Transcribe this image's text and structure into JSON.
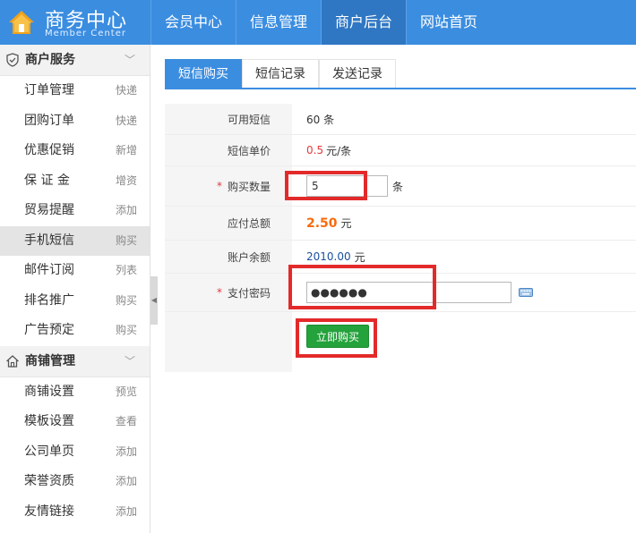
{
  "header": {
    "logo_title": "商务中心",
    "logo_sub": "Member Center",
    "nav": [
      {
        "label": "会员中心"
      },
      {
        "label": "信息管理"
      },
      {
        "label": "商户后台"
      },
      {
        "label": "网站首页"
      }
    ],
    "active_nav": "商户后台"
  },
  "sidebar": {
    "sections": [
      {
        "title": "商户服务",
        "icon": "shield-icon",
        "items": [
          {
            "label": "订单管理",
            "tag": "快递"
          },
          {
            "label": "团购订单",
            "tag": "快递"
          },
          {
            "label": "优惠促销",
            "tag": "新增"
          },
          {
            "label": "保 证 金",
            "tag": "增资"
          },
          {
            "label": "贸易提醒",
            "tag": "添加"
          },
          {
            "label": "手机短信",
            "tag": "购买"
          },
          {
            "label": "邮件订阅",
            "tag": "列表"
          },
          {
            "label": "排名推广",
            "tag": "购买"
          },
          {
            "label": "广告预定",
            "tag": "购买"
          }
        ]
      },
      {
        "title": "商铺管理",
        "icon": "home-icon",
        "items": [
          {
            "label": "商铺设置",
            "tag": "预览"
          },
          {
            "label": "模板设置",
            "tag": "查看"
          },
          {
            "label": "公司单页",
            "tag": "添加"
          },
          {
            "label": "荣誉资质",
            "tag": "添加"
          },
          {
            "label": "友情链接",
            "tag": "添加"
          }
        ]
      }
    ],
    "active_item": "手机短信"
  },
  "tabs": [
    {
      "label": "短信购买"
    },
    {
      "label": "短信记录"
    },
    {
      "label": "发送记录"
    }
  ],
  "form": {
    "available_label": "可用短信",
    "available_value": "60 条",
    "price_label": "短信单价",
    "price_value": "0.5",
    "price_unit": "元/条",
    "qty_label": "购买数量",
    "qty_value": "5",
    "qty_unit": "条",
    "total_label": "应付总额",
    "total_value": "2.50",
    "total_unit": "元",
    "balance_label": "账户余额",
    "balance_value": "2010.00",
    "balance_unit": "元",
    "pwd_label": "支付密码",
    "pwd_value": "●●●●●●",
    "required_mark": "*",
    "submit_label": "立即购买"
  },
  "colors": {
    "brand": "#3b8de0",
    "nav_active": "#2f77c3",
    "button": "#24a23b",
    "price_red": "#e4393c",
    "total_orange": "#f76b0c",
    "highlight": "#e32a2a"
  }
}
